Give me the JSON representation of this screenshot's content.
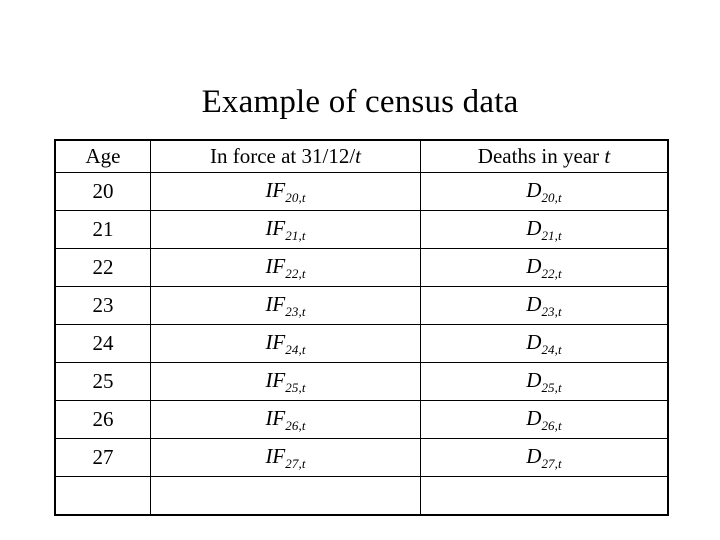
{
  "slide": {
    "title": "Example of census data",
    "background_color": "#ffffff",
    "text_color": "#000000"
  },
  "table": {
    "headers": [
      {
        "text": "Age",
        "italic_tail": ""
      },
      {
        "text": "In force at 31/12/",
        "italic_tail": "t"
      },
      {
        "text": "Deaths in year ",
        "italic_tail": "t"
      }
    ],
    "rows": [
      {
        "age": "20",
        "in_force_base": "IF",
        "in_force_sub": "20,t",
        "deaths_base": "D",
        "deaths_sub": "20,t"
      },
      {
        "age": "21",
        "in_force_base": "IF",
        "in_force_sub": "21,t",
        "deaths_base": "D",
        "deaths_sub": "21,t"
      },
      {
        "age": "22",
        "in_force_base": "IF",
        "in_force_sub": "22,t",
        "deaths_base": "D",
        "deaths_sub": "22,t"
      },
      {
        "age": "23",
        "in_force_base": "IF",
        "in_force_sub": "23,t",
        "deaths_base": "D",
        "deaths_sub": "23,t"
      },
      {
        "age": "24",
        "in_force_base": "IF",
        "in_force_sub": "24,t",
        "deaths_base": "D",
        "deaths_sub": "24,t"
      },
      {
        "age": "25",
        "in_force_base": "IF",
        "in_force_sub": "25,t",
        "deaths_base": "D",
        "deaths_sub": "25,t"
      },
      {
        "age": "26",
        "in_force_base": "IF",
        "in_force_sub": "26,t",
        "deaths_base": "D",
        "deaths_sub": "26,t"
      },
      {
        "age": "27",
        "in_force_base": "IF",
        "in_force_sub": "27,t",
        "deaths_base": "D",
        "deaths_sub": "27,t"
      },
      {
        "age": "",
        "in_force_base": "",
        "in_force_sub": "",
        "deaths_base": "",
        "deaths_sub": ""
      }
    ]
  }
}
